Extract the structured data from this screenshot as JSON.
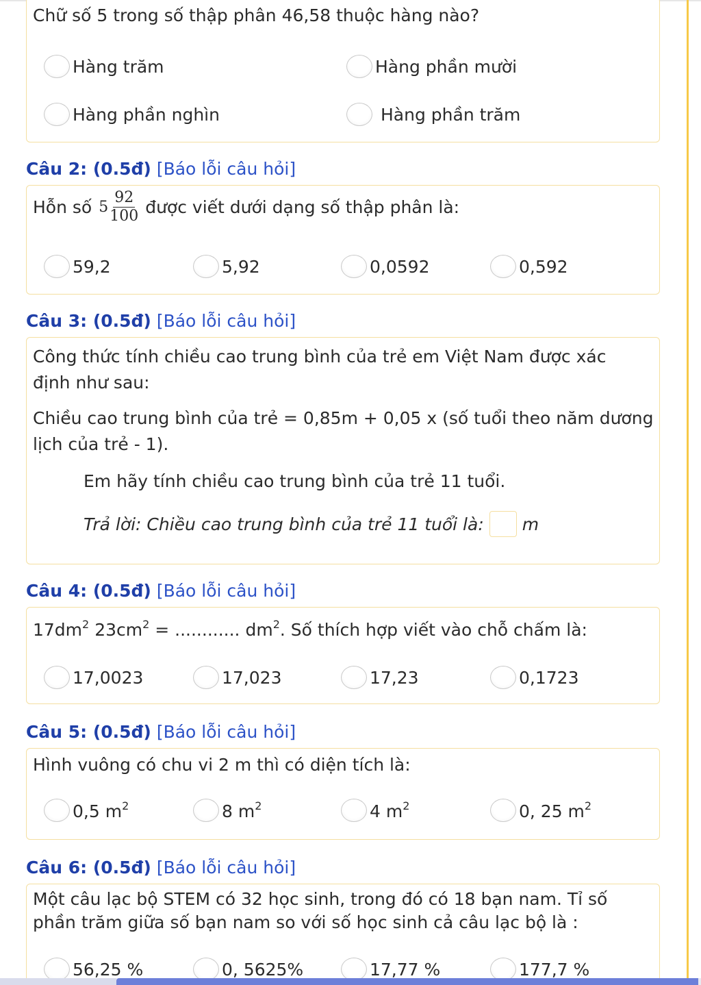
{
  "q1": {
    "question": "Chữ số 5 trong số thập phân 46,58 thuộc hàng nào?",
    "options": [
      "Hàng trăm",
      "Hàng phần mười",
      "Hàng phần nghìn",
      "Hàng phần trăm"
    ]
  },
  "q2": {
    "number": "Câu 2: (0.5đ)",
    "report": "[Báo lỗi câu hỏi]",
    "prefix": "Hỗn số",
    "whole": "5",
    "numerator": "92",
    "denominator": "100",
    "suffix": "được viết dưới dạng số thập phân là:",
    "options": [
      "59,2",
      "5,92",
      "0,0592",
      "0,592"
    ]
  },
  "q3": {
    "number": "Câu 3: (0.5đ)",
    "report": "[Báo lỗi câu hỏi]",
    "line1": "Công thức tính chiều cao trung bình của trẻ em Việt Nam được xác",
    "line2": "định như sau:",
    "line3": "Chiều cao trung bình của trẻ = 0,85m + 0,05 x (số tuổi theo năm dương",
    "line4": "lịch của trẻ - 1).",
    "line5": "Em hãy tính chiều cao trung bình của trẻ 11 tuổi.",
    "answer_label": "Trả lời: Chiều cao trung bình của trẻ 11 tuổi là:",
    "answer_unit": "m"
  },
  "q4": {
    "number": "Câu 4: (0.5đ)",
    "report": "[Báo lỗi câu hỏi]",
    "a": "17dm",
    "b": "23cm",
    "eq": "= ............",
    "c": "dm",
    "exp": "2",
    "suffix": ". Số thích hợp viết vào chỗ chấm là:",
    "options": [
      "17,0023",
      "17,023",
      "17,23",
      "0,1723"
    ]
  },
  "q5": {
    "number": "Câu 5: (0.5đ)",
    "report": "[Báo lỗi câu hỏi]",
    "question": "Hình vuông có chu vi 2 m thì có diện tích là:",
    "options": [
      "0,5 m",
      "8 m",
      "4 m",
      "0, 25 m"
    ],
    "exp": "2"
  },
  "q6": {
    "number": "Câu 6: (0.5đ)",
    "report": "[Báo lỗi câu hỏi]",
    "line1": "Một câu lạc bộ STEM có 32 học sinh, trong đó có 18 bạn nam. Tỉ số",
    "line2": "phần trăm giữa số bạn nam so với số học sinh cả câu lạc bộ là :",
    "options": [
      "56,25 %",
      "0, 5625%",
      "17,77 %",
      "177,7 %"
    ]
  },
  "colors": {
    "accent": "#1f3fa8",
    "link": "#2c52c7",
    "border": "#f5dfa0",
    "progress": "#6d7fd9"
  }
}
